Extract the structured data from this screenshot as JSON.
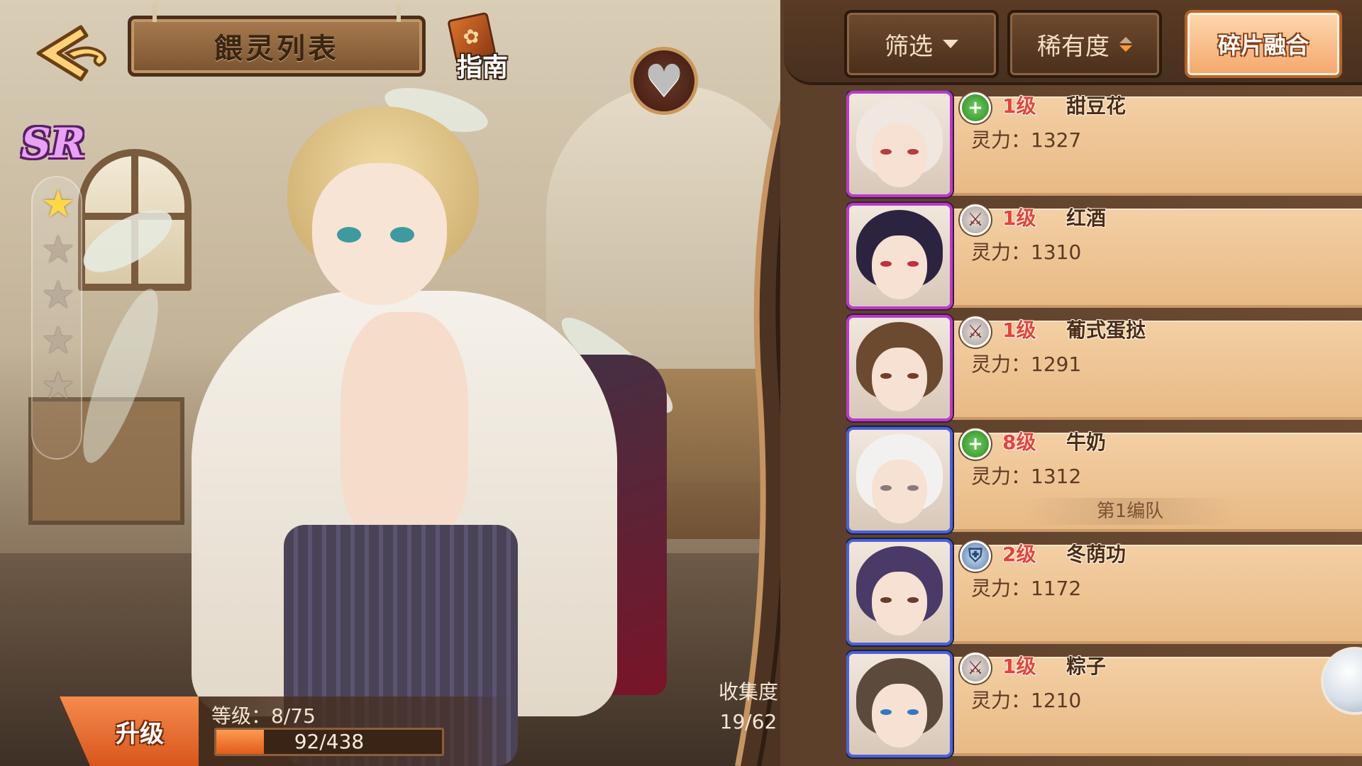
{
  "header": {
    "title": "餵灵列表",
    "guide_label": "指南"
  },
  "character": {
    "rarity": "SR",
    "stars_total": 5,
    "stars_filled": 1
  },
  "toolbar": {
    "filter_label": "筛选",
    "rarity_sort_label": "稀有度",
    "fuse_label": "碎片融合"
  },
  "spirits": [
    {
      "level": "1级",
      "name": "甜豆花",
      "power": "灵力：1327",
      "type": "heal-icon",
      "frame": "purple",
      "team": ""
    },
    {
      "level": "1级",
      "name": "红酒",
      "power": "灵力：1310",
      "type": "attack-icon",
      "frame": "purple",
      "team": ""
    },
    {
      "level": "1级",
      "name": "葡式蛋挞",
      "power": "灵力：1291",
      "type": "attack-icon",
      "frame": "purple",
      "team": ""
    },
    {
      "level": "8级",
      "name": "牛奶",
      "power": "灵力：1312",
      "type": "heal-icon",
      "frame": "blue",
      "team": "第1编队"
    },
    {
      "level": "2级",
      "name": "冬荫功",
      "power": "灵力：1172",
      "type": "defense-icon",
      "frame": "blue",
      "team": ""
    },
    {
      "level": "1级",
      "name": "粽子",
      "power": "灵力：1210",
      "type": "attack-icon",
      "frame": "blue",
      "team": ""
    }
  ],
  "upgrade": {
    "button_label": "升级",
    "level_text": "等级：8/75",
    "exp_text": "92/438",
    "exp_current": 92,
    "exp_max": 438
  },
  "collection": {
    "label": "收集度",
    "value": "19/62"
  },
  "colors": {
    "rarity_sr": "#e8a2f2",
    "level_red": "#e8423a",
    "frame_purple": "#b83ac9",
    "frame_blue": "#4d60d6",
    "accent_orange": "#e25c1a"
  }
}
